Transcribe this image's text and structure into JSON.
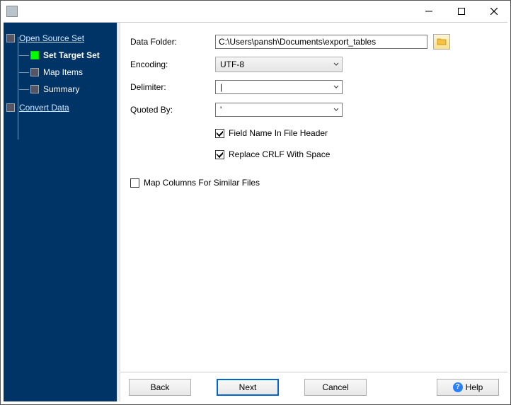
{
  "titlebar": {
    "title": ""
  },
  "sidebar": {
    "items": [
      {
        "label": "Open Source Set",
        "active": false,
        "link": true,
        "indent": 0
      },
      {
        "label": "Set Target Set",
        "active": true,
        "link": false,
        "indent": 1
      },
      {
        "label": "Map Items",
        "active": false,
        "link": false,
        "indent": 1
      },
      {
        "label": "Summary",
        "active": false,
        "link": false,
        "indent": 1
      },
      {
        "label": "Convert Data",
        "active": false,
        "link": true,
        "indent": 0
      }
    ]
  },
  "form": {
    "dataFolder": {
      "label": "Data Folder:",
      "value": "C:\\Users\\pansh\\Documents\\export_tables"
    },
    "encoding": {
      "label": "Encoding:",
      "value": "UTF-8"
    },
    "delimiter": {
      "label": "Delimiter:",
      "value": "|"
    },
    "quotedBy": {
      "label": "Quoted By:",
      "value": "'"
    },
    "fieldNameHeader": {
      "label": "Field Name In File Header",
      "checked": true
    },
    "replaceCrlf": {
      "label": "Replace CRLF With Space",
      "checked": true
    },
    "mapColumns": {
      "label": "Map Columns For Similar Files",
      "checked": false
    }
  },
  "buttons": {
    "back": "Back",
    "next": "Next",
    "cancel": "Cancel",
    "help": "Help"
  }
}
